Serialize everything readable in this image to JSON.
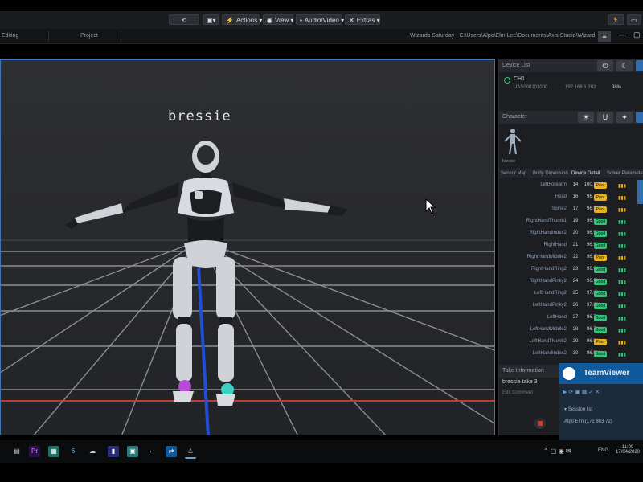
{
  "toolbar": {
    "actions_label": "Actions",
    "view_label": "View",
    "audio_video_label": "Audio/Video",
    "extras_label": "Extras"
  },
  "tabs": {
    "editing": "Editing",
    "project": "Project",
    "path": "Wizards Saturday - C:\\Users\\Alpo\\Elm Lee\\Documents\\Axis Studio\\Wizards Saturday"
  },
  "viewport": {
    "character_name": "bressie"
  },
  "device_list": {
    "header": "Device List",
    "device_name": "CH1",
    "device_serial": "UAS000101000",
    "device_ip": "192.168.1.202",
    "device_battery": "98%"
  },
  "character": {
    "header": "Character",
    "label": "bressie"
  },
  "detail_tabs": [
    "Sensor Map",
    "Body Dimension",
    "Device Detail",
    "Solver Parameter"
  ],
  "device_detail": {
    "rows": [
      {
        "name": "LeftForearm",
        "id": "14",
        "pct": "100.1%",
        "status": "Poor",
        "color": "#e8b21c"
      },
      {
        "name": "Head",
        "id": "16",
        "pct": "96.7%",
        "status": "Poor",
        "color": "#e8b21c"
      },
      {
        "name": "Spine2",
        "id": "17",
        "pct": "96.9%",
        "status": "Poor",
        "color": "#e8b21c"
      },
      {
        "name": "RightHandThumb1",
        "id": "19",
        "pct": "96.9%",
        "status": "Good",
        "color": "#34c27a"
      },
      {
        "name": "RightHandIndex2",
        "id": "20",
        "pct": "96.9%",
        "status": "Good",
        "color": "#34c27a"
      },
      {
        "name": "RightHand",
        "id": "21",
        "pct": "96.9%",
        "status": "Good",
        "color": "#34c27a"
      },
      {
        "name": "RightHandMiddle2",
        "id": "22",
        "pct": "96.9%",
        "status": "Poor",
        "color": "#e8b21c"
      },
      {
        "name": "RightHandRing2",
        "id": "23",
        "pct": "96.9%",
        "status": "Good",
        "color": "#34c27a"
      },
      {
        "name": "RightHandPinky2",
        "id": "24",
        "pct": "96.9%",
        "status": "Good",
        "color": "#34c27a"
      },
      {
        "name": "LeftHandRing2",
        "id": "25",
        "pct": "97.8%",
        "status": "Good",
        "color": "#34c27a"
      },
      {
        "name": "LeftHandPinky2",
        "id": "26",
        "pct": "97.8%",
        "status": "Good",
        "color": "#34c27a"
      },
      {
        "name": "LeftHand",
        "id": "27",
        "pct": "96.7%",
        "status": "Good",
        "color": "#34c27a"
      },
      {
        "name": "LeftHandMiddle2",
        "id": "28",
        "pct": "96.7%",
        "status": "Good",
        "color": "#34c27a"
      },
      {
        "name": "LeftHandThumb2",
        "id": "29",
        "pct": "96.9%",
        "status": "Poor",
        "color": "#e8b21c"
      },
      {
        "name": "LeftHandIndex2",
        "id": "30",
        "pct": "96.9%",
        "status": "Good",
        "color": "#34c27a"
      }
    ]
  },
  "take_info": {
    "header": "Take Information",
    "take_name": "bressie take 3",
    "edit_comment": "Edit Comment"
  },
  "teamviewer": {
    "title": "TeamViewer",
    "session_list": "Session list",
    "session_item": "Alpo Elm (172 863 72)"
  },
  "taskbar": {
    "time": "11:09",
    "date": "17/04/2020",
    "lang": "ENG"
  },
  "colors": {
    "accent": "#2d6fb0",
    "good": "#34c27a",
    "poor": "#e8b21c"
  }
}
